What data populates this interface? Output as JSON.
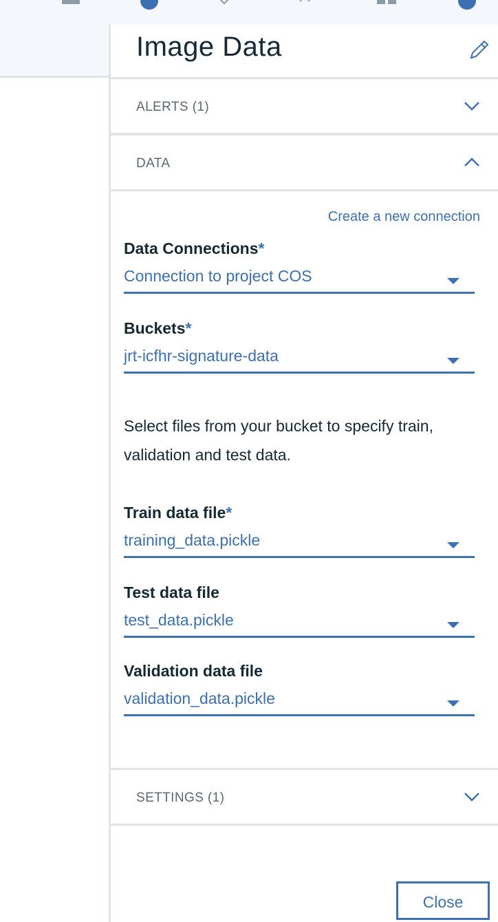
{
  "panel": {
    "title": "Image Data",
    "edit_icon": "pencil-icon"
  },
  "sections": {
    "alerts": {
      "label": "ALERTS (1)",
      "expanded": false
    },
    "data": {
      "label": "DATA",
      "expanded": true
    },
    "settings": {
      "label": "SETTINGS (1)",
      "expanded": false
    }
  },
  "data_section": {
    "create_link": "Create a new connection",
    "connections": {
      "label": "Data Connections",
      "required": "*",
      "value": "Connection to project COS"
    },
    "buckets": {
      "label": "Buckets",
      "required": "*",
      "value": "jrt-icfhr-signature-data"
    },
    "help_text": "Select files from your bucket to specify train, validation and test data.",
    "train": {
      "label": "Train data file",
      "required": "*",
      "value": "training_data.pickle"
    },
    "test": {
      "label": "Test data file",
      "value": "test_data.pickle"
    },
    "validation": {
      "label": "Validation data file",
      "value": "validation_data.pickle"
    }
  },
  "footer": {
    "close_label": "Close"
  },
  "colors": {
    "accent": "#3d70b2",
    "text": "#152935",
    "muted": "#5a6872",
    "border": "#dfe3e6"
  }
}
